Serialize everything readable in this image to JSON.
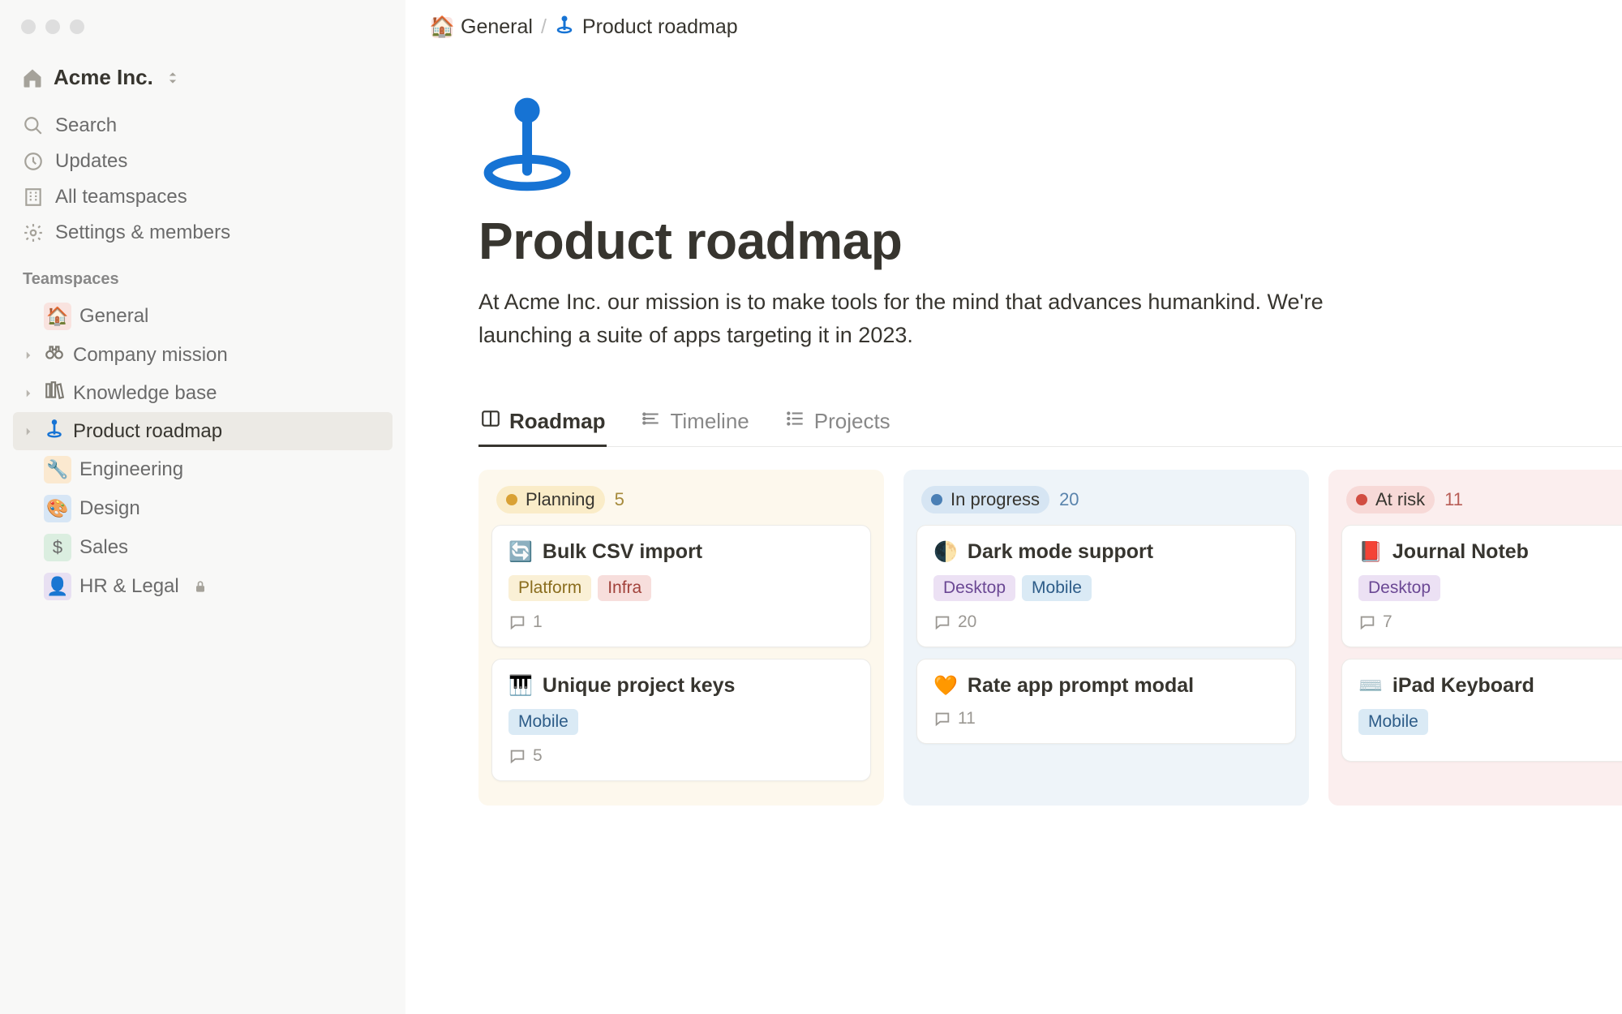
{
  "workspace": {
    "name": "Acme Inc."
  },
  "sidebar": {
    "nav": {
      "search": "Search",
      "updates": "Updates",
      "teamspaces": "All teamspaces",
      "settings": "Settings & members"
    },
    "section_label": "Teamspaces",
    "items": [
      {
        "label": "General",
        "icon_bg": "#f9e3df",
        "emoji": "🏠",
        "type": "emoji"
      },
      {
        "label": "Company mission",
        "type": "svg-binoculars",
        "disclose": true
      },
      {
        "label": "Knowledge base",
        "type": "svg-books",
        "disclose": true
      },
      {
        "label": "Product roadmap",
        "type": "svg-pin",
        "disclose": true,
        "active": true
      },
      {
        "label": "Engineering",
        "icon_bg": "#fbe9d0",
        "emoji": "🔧",
        "type": "emoji"
      },
      {
        "label": "Design",
        "icon_bg": "#d7e6f5",
        "emoji": "🎨",
        "type": "emoji"
      },
      {
        "label": "Sales",
        "icon_bg": "#dbeee0",
        "emoji": "$",
        "type": "emoji"
      },
      {
        "label": "HR & Legal",
        "icon_bg": "#e8e0f2",
        "emoji": "👤",
        "type": "emoji",
        "locked": true
      }
    ]
  },
  "breadcrumb": {
    "root": "General",
    "page": "Product roadmap"
  },
  "page": {
    "title": "Product roadmap",
    "description": "At Acme Inc. our mission is to make tools for the mind that advances humankind. We're launching a suite of apps targeting it in 2023."
  },
  "tabs": [
    {
      "label": "Roadmap",
      "icon": "board",
      "active": true
    },
    {
      "label": "Timeline",
      "icon": "timeline"
    },
    {
      "label": "Projects",
      "icon": "list"
    }
  ],
  "board": {
    "columns": [
      {
        "key": "planning",
        "label": "Planning",
        "count": 5,
        "cards": [
          {
            "emoji": "🔄",
            "title": "Bulk CSV import",
            "tags": [
              "Platform",
              "Infra"
            ],
            "comments": 1
          },
          {
            "emoji": "🎹",
            "title": "Unique project keys",
            "tags": [
              "Mobile"
            ],
            "comments": 5
          }
        ]
      },
      {
        "key": "progress",
        "label": "In progress",
        "count": 20,
        "cards": [
          {
            "emoji": "🌓",
            "title": "Dark mode support",
            "tags": [
              "Desktop",
              "Mobile"
            ],
            "comments": 20
          },
          {
            "emoji": "🧡",
            "title": "Rate app prompt modal",
            "tags": [],
            "comments": 11
          }
        ]
      },
      {
        "key": "atrisk",
        "label": "At risk",
        "count": 11,
        "cards": [
          {
            "emoji": "📕",
            "title": "Journal Noteb",
            "tags": [
              "Desktop"
            ],
            "comments": 7
          },
          {
            "emoji": "⌨️",
            "title": "iPad Keyboard",
            "tags": [
              "Mobile"
            ],
            "comments": null
          }
        ]
      }
    ]
  },
  "tag_classes": {
    "Platform": "tag-platform",
    "Infra": "tag-infra",
    "Mobile": "tag-mobile",
    "Desktop": "tag-desktop"
  }
}
